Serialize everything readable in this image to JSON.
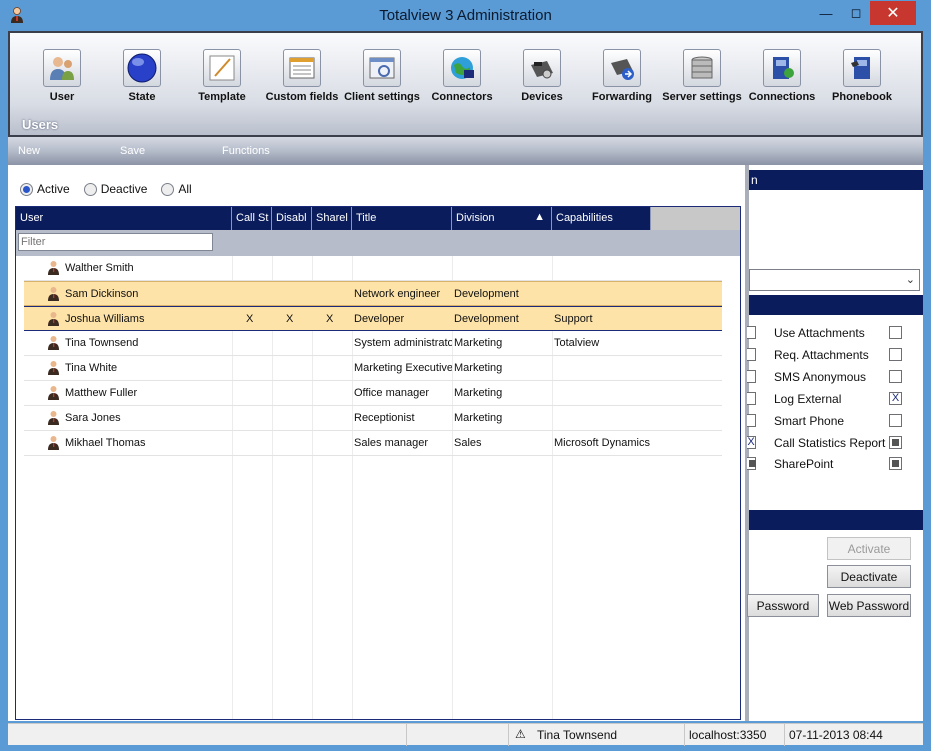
{
  "window": {
    "title": "Totalview 3  Administration"
  },
  "ribbon": {
    "items": [
      {
        "label": "User",
        "icon": "user-icon"
      },
      {
        "label": "State",
        "icon": "state-icon"
      },
      {
        "label": "Template",
        "icon": "template-icon"
      },
      {
        "label": "Custom fields",
        "icon": "custom-fields-icon"
      },
      {
        "label": "Client settings",
        "icon": "client-settings-icon"
      },
      {
        "label": "Connectors",
        "icon": "connectors-icon"
      },
      {
        "label": "Devices",
        "icon": "devices-icon"
      },
      {
        "label": "Forwarding",
        "icon": "forwarding-icon"
      },
      {
        "label": "Server settings",
        "icon": "server-settings-icon"
      },
      {
        "label": "Connections",
        "icon": "connections-icon"
      },
      {
        "label": "Phonebook",
        "icon": "phonebook-icon"
      }
    ],
    "section_title": "Users"
  },
  "toolbar": {
    "new": "New",
    "save": "Save",
    "functions": "Functions"
  },
  "filter_radios": [
    {
      "label": "Active",
      "selected": true
    },
    {
      "label": "Deactive",
      "selected": false
    },
    {
      "label": "All",
      "selected": false
    }
  ],
  "grid": {
    "columns": [
      "User",
      "Call St",
      "Disabl",
      "Sharel",
      "Title",
      "Division",
      "Capabilities"
    ],
    "sort_indicator": "▲",
    "filter_placeholder": "Filter",
    "rows": [
      {
        "user": "Walther Smith",
        "c1": "",
        "c2": "",
        "c3": "",
        "title": "",
        "division": "",
        "capabilities": ""
      },
      {
        "user": "Sam Dickinson",
        "c1": "",
        "c2": "",
        "c3": "",
        "title": "Network engineer",
        "division": "Development",
        "capabilities": ""
      },
      {
        "user": "Joshua Williams",
        "c1": "X",
        "c2": "X",
        "c3": "X",
        "title": "Developer",
        "division": "Development",
        "capabilities": "Support"
      },
      {
        "user": "Tina Townsend",
        "c1": "",
        "c2": "",
        "c3": "",
        "title": "System administrator",
        "division": "Marketing",
        "capabilities": "Totalview"
      },
      {
        "user": "Tina White",
        "c1": "",
        "c2": "",
        "c3": "",
        "title": "Marketing Executive",
        "division": "Marketing",
        "capabilities": ""
      },
      {
        "user": "Matthew Fuller",
        "c1": "",
        "c2": "",
        "c3": "",
        "title": "Office manager",
        "division": "Marketing",
        "capabilities": ""
      },
      {
        "user": "Sara Jones",
        "c1": "",
        "c2": "",
        "c3": "",
        "title": "Receptionist",
        "division": "Marketing",
        "capabilities": ""
      },
      {
        "user": "Mikhael Thomas",
        "c1": "",
        "c2": "",
        "c3": "",
        "title": "Sales manager",
        "division": "Sales",
        "capabilities": "Microsoft Dynamics"
      }
    ]
  },
  "right_panel": {
    "header1": "n",
    "capabilities": [
      {
        "label": "Use Attachments",
        "left": "",
        "right": ""
      },
      {
        "label": "Req. Attachments",
        "left": "",
        "right": ""
      },
      {
        "label": "SMS Anonymous",
        "left": "",
        "right": ""
      },
      {
        "label": "Log External",
        "left": "",
        "right": "X"
      },
      {
        "label": "Smart Phone",
        "left": "",
        "right": ""
      },
      {
        "label": "Call Statistics Report",
        "left": "X",
        "right": "fill"
      },
      {
        "label": "SharePoint",
        "left": "fill",
        "right": "fill"
      }
    ],
    "buttons": {
      "activate": "Activate",
      "deactivate": "Deactivate",
      "password": "Password",
      "web_password": "Web Password"
    }
  },
  "statusbar": {
    "user": "Tina Townsend",
    "server": "localhost:3350",
    "datetime": "07-11-2013 08:44"
  }
}
